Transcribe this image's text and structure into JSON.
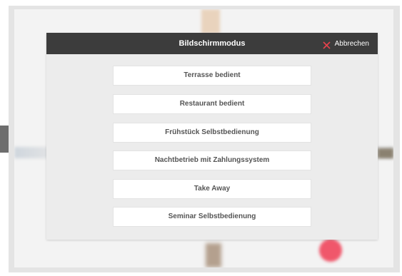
{
  "dialog": {
    "title": "Bildschirmmodus",
    "cancel_label": "Abbrechen",
    "close_icon": "close-icon",
    "accent_color": "#e8424c",
    "header_color": "#3c3c3c"
  },
  "options": [
    {
      "label": "Terrasse bedient"
    },
    {
      "label": "Restaurant bedient"
    },
    {
      "label": "Frühstück Selbstbedienung"
    },
    {
      "label": "Nachtbetrieb mit Zahlungssystem"
    },
    {
      "label": "Take Away"
    },
    {
      "label": "Seminar Selbstbedienung"
    }
  ]
}
